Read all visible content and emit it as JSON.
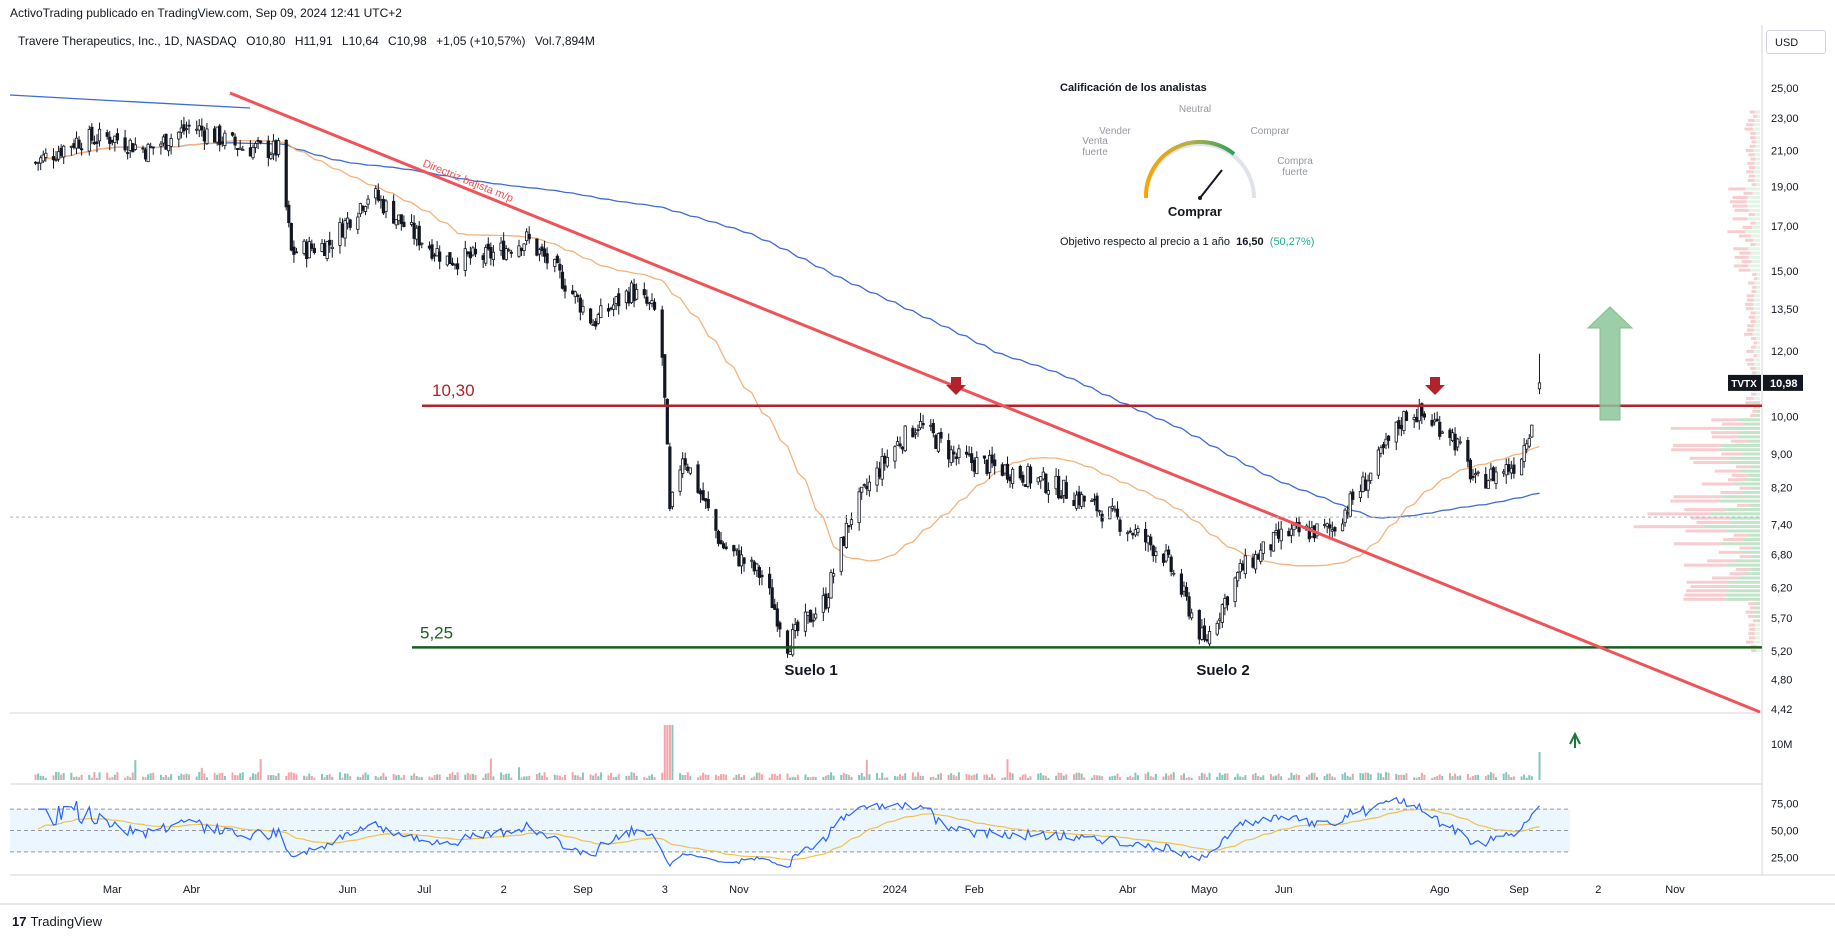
{
  "header": {
    "publisher_note": "ActivoTrading publicado en TradingView.com, Sep 09, 2024 12:41 UTC+2",
    "symbol_title": "Travere Therapeutics, Inc., 1D, NASDAQ",
    "open": "O10,80",
    "high": "H11,91",
    "low": "L10,64",
    "close": "C10,98",
    "change": "+1,05 (+10,57%)",
    "volume": "Vol.7,894M",
    "currency": "USD"
  },
  "brand": {
    "name": "TradingView",
    "logo_icon": "tradingview-logo-icon"
  },
  "analyst_panel": {
    "title": "Calificación de los analistas",
    "labels": [
      "Venta fuerte",
      "Vender",
      "Neutral",
      "Comprar",
      "Compra fuerte"
    ],
    "label_lines": {
      "venta_fuerte": [
        "Venta",
        "fuerte"
      ],
      "vender": "Vender",
      "neutral": "Neutral",
      "comprar": "Comprar",
      "compra_fuerte": [
        "Compra",
        "fuerte"
      ]
    },
    "verdict": "Comprar",
    "target_label": "Objetivo respecto al precio a 1 año",
    "target_value": "16,50",
    "target_pct": "(50,27%)"
  },
  "annotations": {
    "resistance_label": "10,30",
    "support_label": "5,25",
    "trendline_label": "Directriz bajista m/p",
    "floor1": "Suelo 1",
    "floor2": "Suelo 2",
    "ticker_badge": "TVTX",
    "price_badge": "10,98",
    "colors": {
      "resistance": "#b2222a",
      "support": "#1b5e20",
      "trendline": "#ef5358",
      "ma_long": "#3e6bd6",
      "ma_mid": "#f5b27a",
      "up_arrow": "#8bc79a"
    }
  },
  "chart_data": [
    {
      "type": "line",
      "panel": "price",
      "series_type": "candlestick (approximated by close prices)",
      "x": [
        "Mar",
        "Abr",
        "Jun",
        "Jul",
        "2",
        "Sep",
        "3",
        "Nov",
        "2024",
        "Feb",
        "Abr",
        "Mayo",
        "Jun",
        "Ago",
        "Sep",
        "2",
        "Nov"
      ],
      "y_axis_ticks": [
        "25,00",
        "23,00",
        "21,00",
        "19,00",
        "17,00",
        "15,00",
        "13,50",
        "12,00",
        "10,00",
        "9,00",
        "8,20",
        "7,40",
        "6,80",
        "6,20",
        "5,70",
        "5,20",
        "4,80",
        "4,42"
      ],
      "ylim": [
        4.42,
        25
      ],
      "y_scale": "log",
      "close_path": [
        [
          "2023-01-30",
          20.3
        ],
        [
          "2023-02-15",
          21.6
        ],
        [
          "2023-03-01",
          21.8
        ],
        [
          "2023-03-15",
          21.0
        ],
        [
          "2023-04-01",
          22.5
        ],
        [
          "2023-04-20",
          21.2
        ],
        [
          "2023-05-05",
          21.0
        ],
        [
          "2023-05-10",
          15.8
        ],
        [
          "2023-05-25",
          16.2
        ],
        [
          "2023-06-10",
          18.7
        ],
        [
          "2023-06-25",
          16.8
        ],
        [
          "2023-07-10",
          15.5
        ],
        [
          "2023-07-25",
          15.6
        ],
        [
          "2023-08-10",
          16.4
        ],
        [
          "2023-08-20",
          15.2
        ],
        [
          "2023-09-05",
          13.0
        ],
        [
          "2023-09-20",
          14.2
        ],
        [
          "2023-10-01",
          13.2
        ],
        [
          "2023-10-05",
          7.6
        ],
        [
          "2023-10-10",
          9.0
        ],
        [
          "2023-10-25",
          7.0
        ],
        [
          "2023-11-10",
          6.4
        ],
        [
          "2023-11-20",
          5.3
        ],
        [
          "2023-12-05",
          6.0
        ],
        [
          "2023-12-15",
          7.6
        ],
        [
          "2024-01-01",
          9.2
        ],
        [
          "2024-01-10",
          9.8
        ],
        [
          "2024-01-25",
          8.9
        ],
        [
          "2024-02-15",
          8.6
        ],
        [
          "2024-03-05",
          8.2
        ],
        [
          "2024-03-25",
          7.6
        ],
        [
          "2024-04-15",
          6.8
        ],
        [
          "2024-05-01",
          5.3
        ],
        [
          "2024-05-15",
          6.5
        ],
        [
          "2024-06-01",
          7.2
        ],
        [
          "2024-06-20",
          7.3
        ],
        [
          "2024-07-05",
          8.5
        ],
        [
          "2024-07-20",
          10.2
        ],
        [
          "2024-08-05",
          9.6
        ],
        [
          "2024-08-15",
          8.3
        ],
        [
          "2024-09-01",
          8.8
        ],
        [
          "2024-09-06",
          9.9
        ],
        [
          "2024-09-09",
          10.98
        ]
      ],
      "levels": [
        {
          "name": "10,30",
          "value": 10.3
        },
        {
          "name": "5,25",
          "value": 5.25
        }
      ],
      "last_price": 10.98,
      "ticker": "TVTX"
    },
    {
      "type": "bar",
      "panel": "volume",
      "y_axis_ticks": [
        "10M"
      ]
    },
    {
      "type": "line",
      "panel": "rsi",
      "y_axis_ticks": [
        "75,00",
        "50,00",
        "25,00"
      ],
      "ylim": [
        15,
        85
      ],
      "bands": [
        30,
        70
      ],
      "last_value": 73
    }
  ]
}
